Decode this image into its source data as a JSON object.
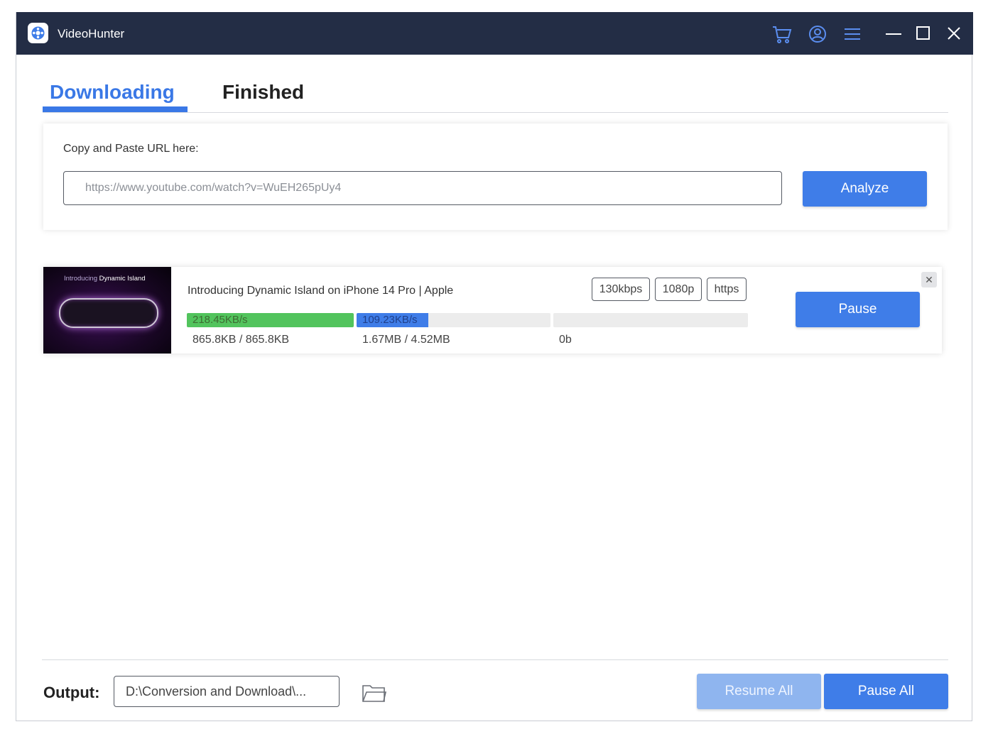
{
  "app": {
    "title": "VideoHunter"
  },
  "titlebar": {
    "icons": [
      "cart-icon",
      "account-icon",
      "menu-icon",
      "minimize-icon",
      "maximize-icon",
      "close-icon"
    ]
  },
  "tabs": [
    {
      "label": "Downloading",
      "active": true
    },
    {
      "label": "Finished",
      "active": false
    }
  ],
  "url_section": {
    "label": "Copy and Paste URL here:",
    "value": "https://www.youtube.com/watch?v=WuEH265pUy4",
    "analyze_label": "Analyze"
  },
  "download_item": {
    "thumbnail_caption_prefix": "Introducing",
    "thumbnail_caption_highlight": "Dynamic Island",
    "title": "Introducing Dynamic Island on iPhone 14 Pro | Apple",
    "badges": [
      "130kbps",
      "1080p",
      "https"
    ],
    "audio": {
      "speed": "218.45KB/s",
      "size": "865.8KB / 865.8KB",
      "progress": 1.0,
      "color": "#52c45d"
    },
    "video": {
      "speed": "109.23KB/s",
      "size": "1.67MB / 4.52MB",
      "progress": 0.37,
      "color": "#3f7de8"
    },
    "merge": {
      "size": "0b",
      "progress": 0.0
    },
    "pause_label": "Pause",
    "close_symbol": "✕"
  },
  "footer": {
    "output_label": "Output:",
    "output_path": "D:\\Conversion and Download\\...",
    "resume_all_label": "Resume All",
    "pause_all_label": "Pause All"
  },
  "colors": {
    "titlebar": "#232d45",
    "accent": "#3f7de8",
    "tab_active": "#3a78e6",
    "disabled_button": "#8fb5ef"
  }
}
